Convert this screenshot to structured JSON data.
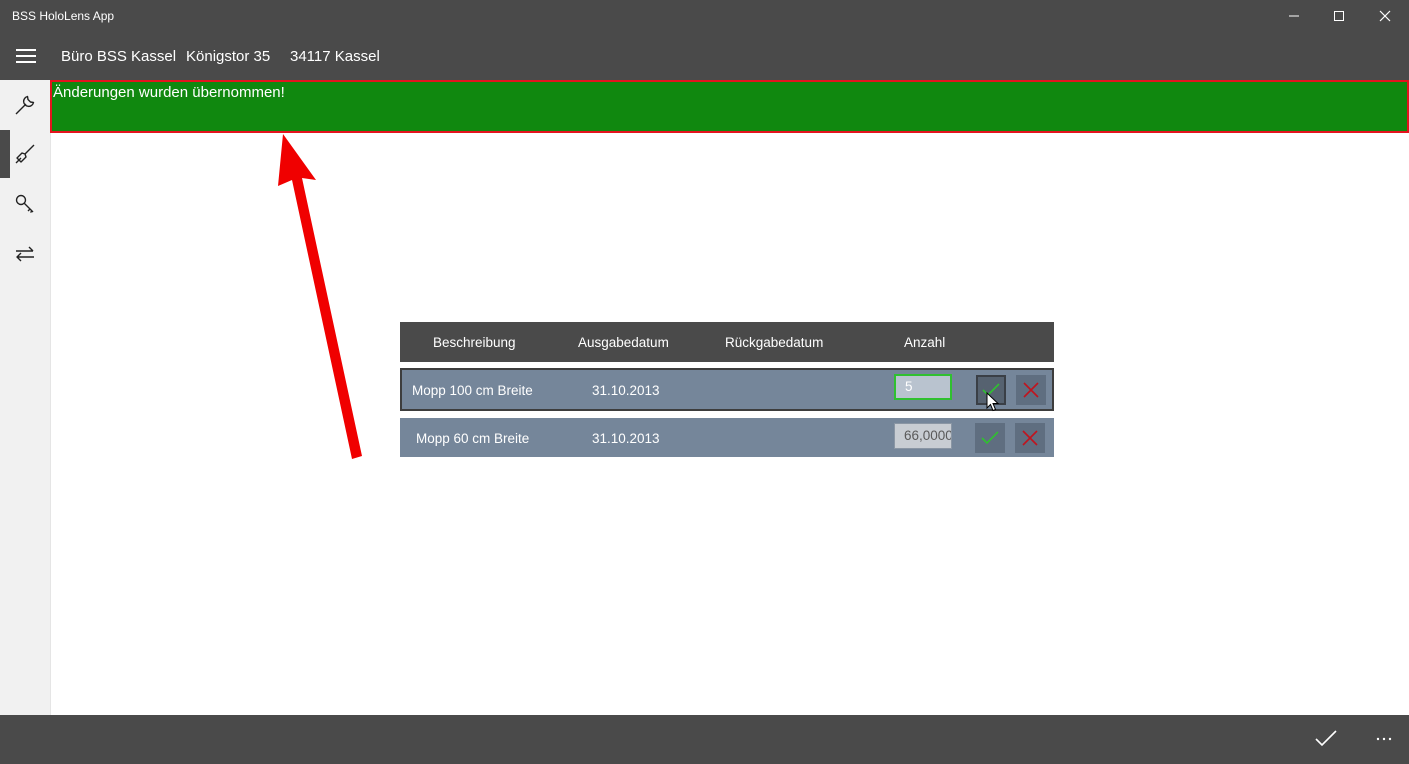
{
  "window": {
    "title": "BSS HoloLens App",
    "controls": [
      "minimize-icon",
      "maximize-icon",
      "close-icon"
    ]
  },
  "header": {
    "location_name": "Büro BSS Kassel",
    "street": "Königstor 35",
    "city": "34117 Kassel"
  },
  "sidebar": {
    "items": [
      {
        "icon": "wrench-icon",
        "active": false
      },
      {
        "icon": "broom-icon",
        "active": true
      },
      {
        "icon": "keys-icon",
        "active": false
      },
      {
        "icon": "swap-arrows-icon",
        "active": false
      }
    ]
  },
  "banner": {
    "message": "Änderungen wurden übernommen!",
    "color": "#10880f",
    "border_color": "#e4141e"
  },
  "table": {
    "columns": [
      "Beschreibung",
      "Ausgabedatum",
      "Rückgabedatum",
      "Anzahl"
    ],
    "rows": [
      {
        "description": "Mopp 100 cm Breite",
        "issue_date": "31.10.2013",
        "return_date": "",
        "quantity": "5"
      },
      {
        "description": "Mopp 60 cm Breite",
        "issue_date": "31.10.2013",
        "return_date": "",
        "quantity": "66,0000"
      }
    ]
  },
  "footer": {
    "actions": [
      "accept-icon",
      "more-icon"
    ]
  },
  "colors": {
    "chrome": "#4a4a4a",
    "row_bg": "#75869a",
    "accept_green": "#30c030",
    "reject_red": "#c0141e",
    "annotation_arrow": "#f00000"
  }
}
